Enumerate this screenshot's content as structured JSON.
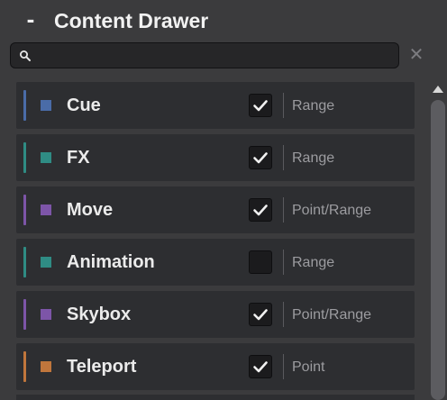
{
  "header": {
    "collapse_label": "-",
    "title": "Content Drawer"
  },
  "search": {
    "placeholder": "",
    "value": "",
    "clear_label": "✕"
  },
  "colors": {
    "cue": "#4a6ca8",
    "fx": "#2f8c84",
    "move": "#7d55a8",
    "animation": "#2f8c84",
    "skybox": "#7d55a8",
    "teleport": "#c0763c"
  },
  "items": [
    {
      "label": "Cue",
      "checked": true,
      "type": "Range",
      "color": "#4a6ca8"
    },
    {
      "label": "FX",
      "checked": true,
      "type": "Range",
      "color": "#2f8c84"
    },
    {
      "label": "Move",
      "checked": true,
      "type": "Point/Range",
      "color": "#7d55a8"
    },
    {
      "label": "Animation",
      "checked": false,
      "type": "Range",
      "color": "#2f8c84"
    },
    {
      "label": "Skybox",
      "checked": true,
      "type": "Point/Range",
      "color": "#7d55a8"
    },
    {
      "label": "Teleport",
      "checked": true,
      "type": "Point",
      "color": "#c0763c"
    }
  ],
  "icons": {
    "search": "search-icon",
    "clear": "close-icon",
    "collapse": "minus-icon",
    "check": "check-icon",
    "scroll_up": "arrow-up-icon"
  }
}
